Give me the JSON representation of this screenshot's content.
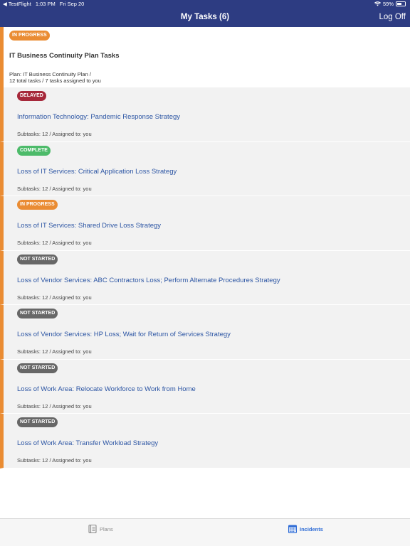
{
  "status_bar": {
    "back_app": "◀ TestFlight",
    "time": "1:03 PM",
    "date": "Fri Sep 20",
    "battery": "59%",
    "battery_level": 0.59
  },
  "nav": {
    "title": "My Tasks (6)",
    "logoff_label": "Log Off"
  },
  "plan": {
    "status": "IN PROGRESS",
    "status_color": "#ea8c33",
    "title": "IT Business Continuity Plan Tasks",
    "subtitle_line1": "Plan: IT Business Continuity Plan /",
    "subtitle_line2": "12 total tasks / 7 tasks assigned to you"
  },
  "tasks": [
    {
      "status": "DELAYED",
      "status_color": "#a6283a",
      "title": "Information Technology: Pandemic Response Strategy",
      "meta": "Subtasks: 12 / Assigned to: you"
    },
    {
      "status": "COMPLETE",
      "status_color": "#4dbb6a",
      "title": "Loss of IT Services: Critical Application Loss Strategy",
      "meta": "Subtasks: 12 / Assigned to: you"
    },
    {
      "status": "IN PROGRESS",
      "status_color": "#ea8c33",
      "title": "Loss of IT Services: Shared Drive Loss Strategy",
      "meta": "Subtasks: 12 / Assigned to: you"
    },
    {
      "status": "NOT STARTED",
      "status_color": "#676767",
      "title": "Loss of Vendor Services: ABC Contractors Loss; Perform Alternate Procedures Strategy",
      "meta": "Subtasks: 12 / Assigned to: you"
    },
    {
      "status": "NOT STARTED",
      "status_color": "#676767",
      "title": "Loss of Vendor Services: HP Loss; Wait for Return of Services Strategy",
      "meta": "Subtasks: 12 / Assigned to: you"
    },
    {
      "status": "NOT STARTED",
      "status_color": "#676767",
      "title": "Loss of Work Area: Relocate Workforce to Work from Home",
      "meta": "Subtasks: 12 / Assigned to: you"
    },
    {
      "status": "NOT STARTED",
      "status_color": "#676767",
      "title": "Loss of Work Area: Transfer Workload Strategy",
      "meta": "Subtasks: 12 / Assigned to: you"
    }
  ],
  "tab_bar": {
    "plans": {
      "label": "Plans",
      "icon": "book-icon"
    },
    "incidents": {
      "label": "Incidents",
      "icon": "calendar-icon",
      "active": true
    }
  },
  "colors": {
    "nav": "#2d3c82",
    "accent": "#ea8c33",
    "link": "#2d56a4",
    "active_tab": "#2d6bd6"
  }
}
